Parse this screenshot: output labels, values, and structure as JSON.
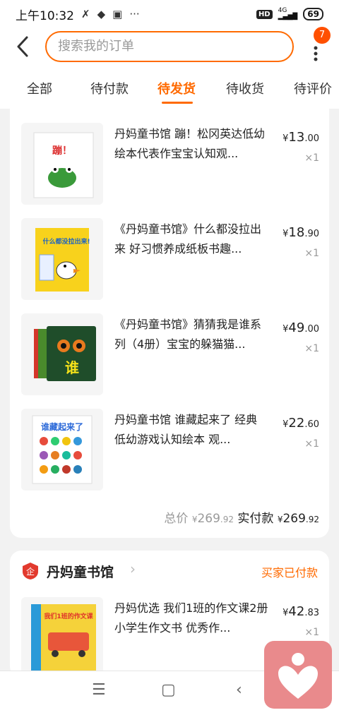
{
  "status_bar": {
    "time": "上午10:32",
    "network": "4G",
    "battery": "69",
    "hd": "HD"
  },
  "header": {
    "search_placeholder": "搜索我的订单",
    "badge_count": "7"
  },
  "tabs": [
    {
      "label": "全部",
      "active": false
    },
    {
      "label": "待付款",
      "active": false
    },
    {
      "label": "待发货",
      "active": true
    },
    {
      "label": "待收货",
      "active": false
    },
    {
      "label": "待评价",
      "active": false
    }
  ],
  "order1": {
    "items": [
      {
        "title": "丹妈童书馆 蹦！松冈英达低幼绘本代表作宝宝认知观...",
        "price_int": "13",
        "price_dec": ".00",
        "qty": "×1"
      },
      {
        "title": "《丹妈童书馆》什么都没拉出来 好习惯养成纸板书趣...",
        "price_int": "18",
        "price_dec": ".90",
        "qty": "×1"
      },
      {
        "title": "《丹妈童书馆》猜猜我是谁系列（4册）宝宝的躲猫猫...",
        "price_int": "49",
        "price_dec": ".00",
        "qty": "×1"
      },
      {
        "title": "丹妈童书馆 谁藏起来了 经典低幼游戏认知绘本 观...",
        "price_int": "22",
        "price_dec": ".60",
        "qty": "×1"
      }
    ],
    "total_label": "总价",
    "total_int": "269",
    "total_dec": ".92",
    "paid_label": "实付款",
    "paid_int": "269",
    "paid_dec": ".92",
    "currency": "¥"
  },
  "order2": {
    "shop_name": "丹妈童书馆",
    "status": "买家已付款",
    "items": [
      {
        "title": "丹妈优选 我们1班的作文课2册 小学生作文书 优秀作...",
        "price_int": "42",
        "price_dec": ".83",
        "qty": "×1"
      }
    ]
  },
  "book_covers": {
    "b1": "蹦！",
    "b2": "什么都没拉出来!",
    "b3": "谁",
    "b4": "谁藏起来了",
    "b5": "我们1班的作文课"
  },
  "colors": {
    "accent": "#ff6a00",
    "badge": "#ff5000"
  }
}
